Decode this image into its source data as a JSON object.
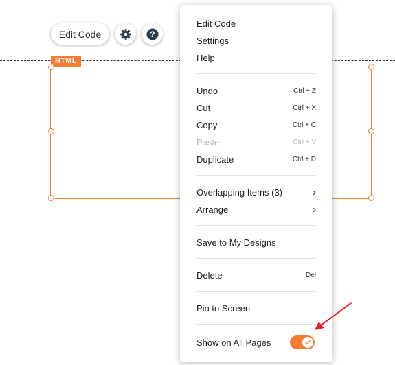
{
  "toolbar": {
    "edit_code_label": "Edit Code",
    "settings_icon": "gear-icon",
    "help_icon": "question-icon"
  },
  "element": {
    "tag_label": "HTML",
    "accent_color": "#f37c33"
  },
  "context_menu": {
    "edit_code": "Edit Code",
    "settings": "Settings",
    "help": "Help",
    "undo": {
      "label": "Undo",
      "shortcut": "Ctrl + Z"
    },
    "cut": {
      "label": "Cut",
      "shortcut": "Ctrl + X"
    },
    "copy": {
      "label": "Copy",
      "shortcut": "Ctrl + C"
    },
    "paste": {
      "label": "Paste",
      "shortcut": "Ctrl + V",
      "disabled": true
    },
    "duplicate": {
      "label": "Duplicate",
      "shortcut": "Ctrl + D"
    },
    "overlapping_items": "Overlapping Items (3)",
    "arrange": "Arrange",
    "save_to_designs": "Save to My Designs",
    "delete": {
      "label": "Delete",
      "shortcut": "Del"
    },
    "pin_to_screen": "Pin to Screen",
    "show_on_all_pages": {
      "label": "Show on All Pages",
      "enabled": true
    }
  },
  "annotation": {
    "arrow_color": "#e02020"
  }
}
